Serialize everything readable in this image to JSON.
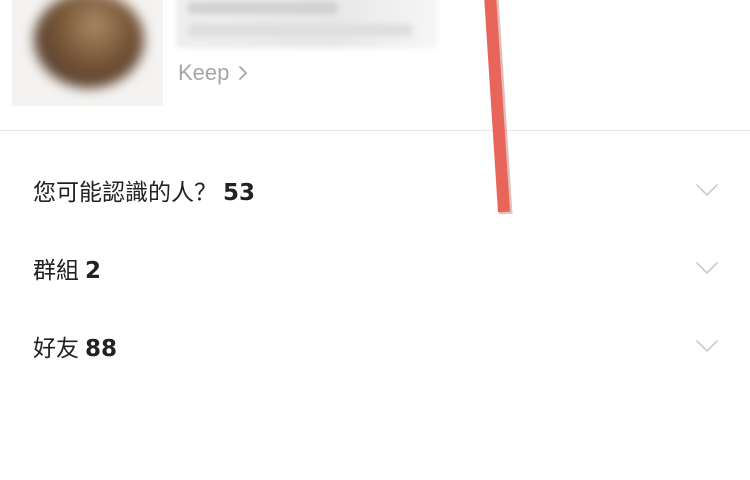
{
  "profile": {
    "keep_label": "Keep"
  },
  "sections": [
    {
      "label": "您可能認識的人？",
      "count": "53",
      "toggle_icon": "chevron-down-icon"
    },
    {
      "label": "群組",
      "count": "2",
      "toggle_icon": "chevron-down-icon"
    },
    {
      "label": "好友",
      "count": "88",
      "toggle_icon": "chevron-down-icon"
    }
  ],
  "colors": {
    "annotation": "#e8655a",
    "label": "#222222",
    "muted": "#a6a6a6",
    "chevron": "#cccccc",
    "divider": "#e6e6e6"
  }
}
